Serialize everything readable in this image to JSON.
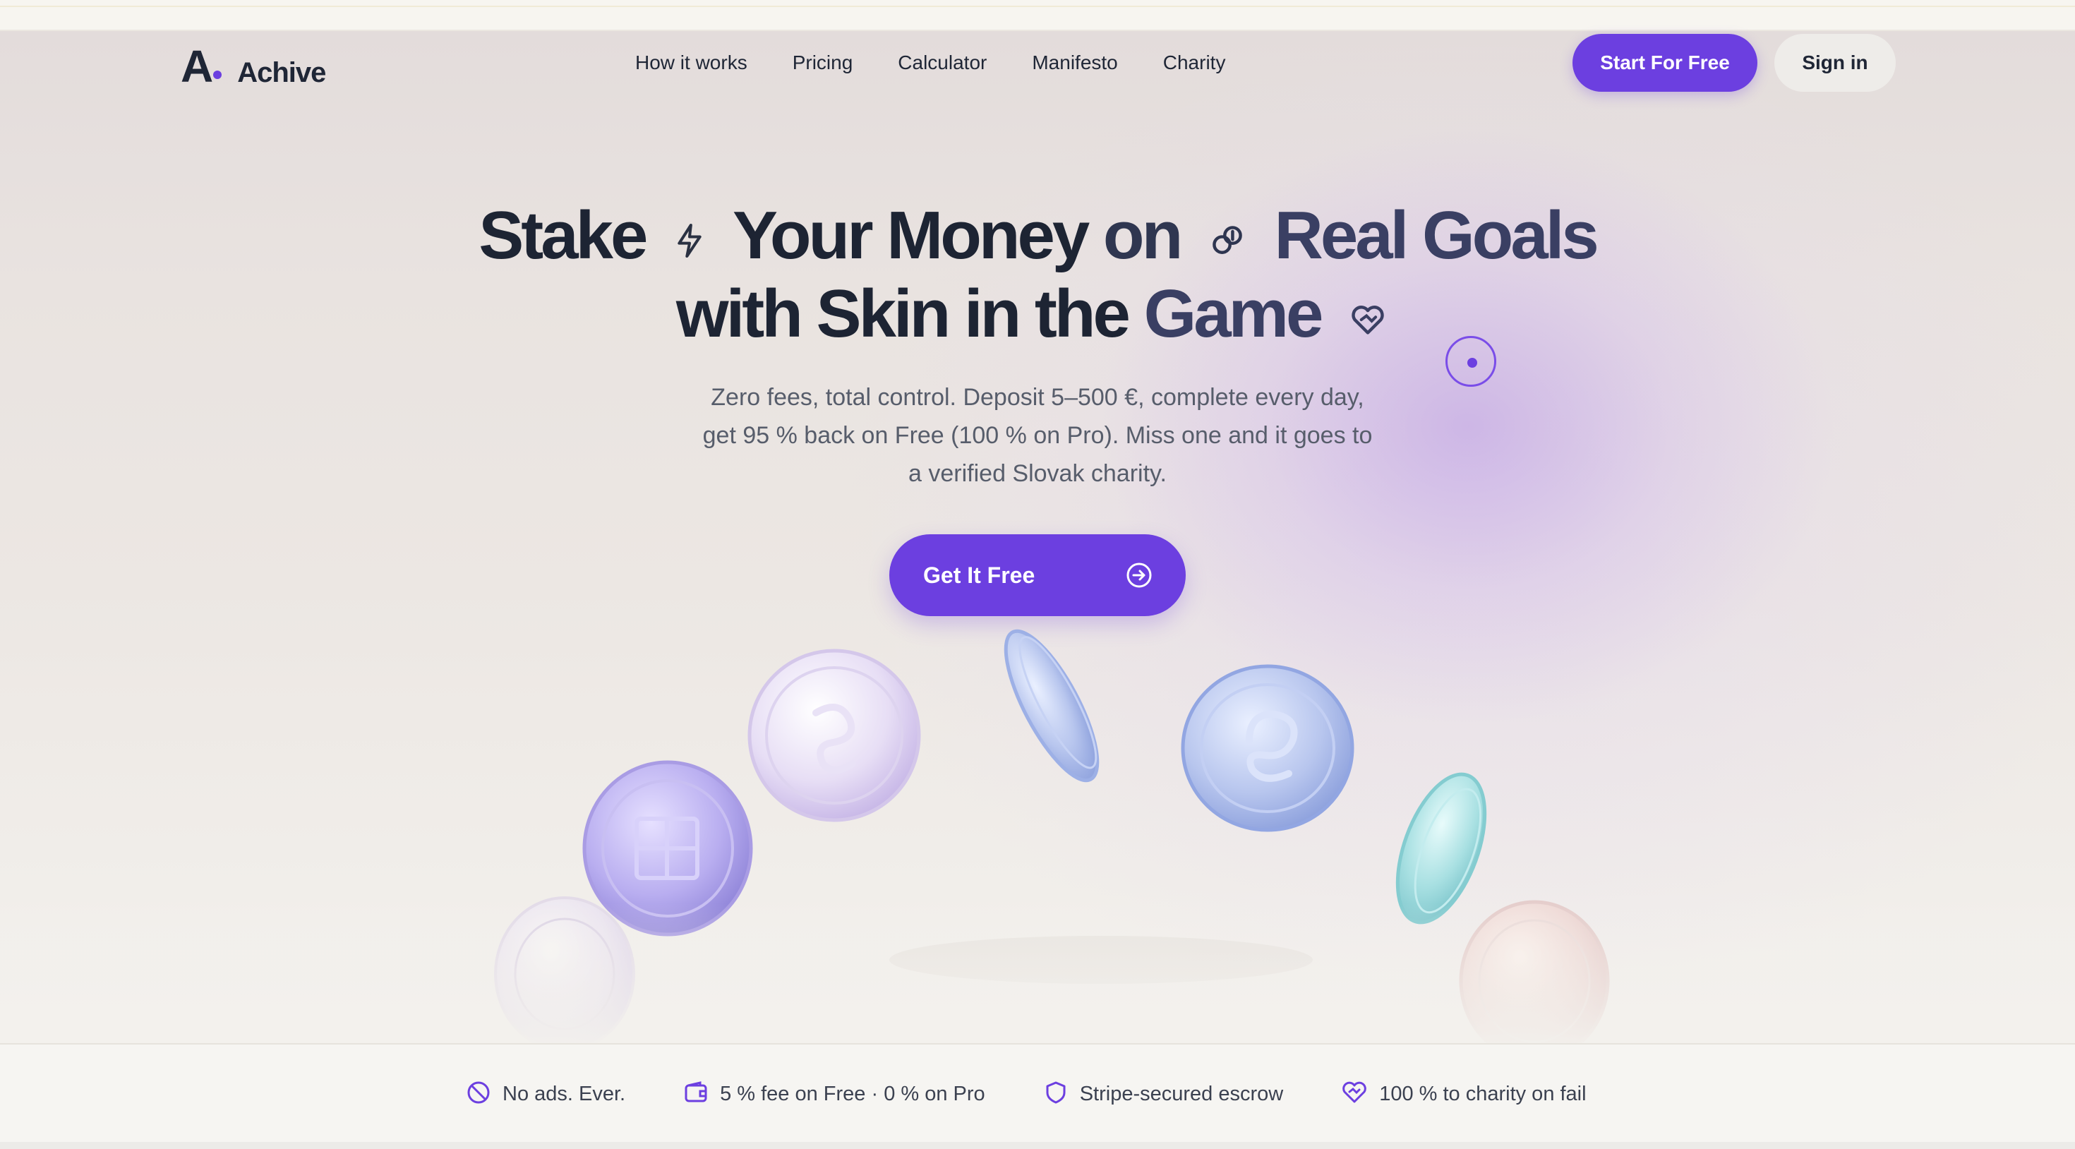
{
  "brand": {
    "mark": "A",
    "name": "Achive",
    "accent": "#6c3fe0"
  },
  "nav": {
    "links": [
      "How it works",
      "Pricing",
      "Calculator",
      "Manifesto",
      "Charity"
    ],
    "start_label": "Start For Free",
    "signin_label": "Sign in"
  },
  "hero": {
    "line1": {
      "a": "Stake",
      "b": "Your Money",
      "c": "on",
      "d": "Real Goals"
    },
    "line2": {
      "a": "with Skin in the",
      "b": "Game"
    },
    "sub_1": "Zero fees, total control. Deposit 5–500 €, complete every day,",
    "sub_2": "get 95 % back on Free (100 % on Pro). Miss one and it goes to",
    "sub_3": "a verified Slovak charity.",
    "cta_label": "Get It Free",
    "icons": [
      "lightning-icon",
      "link-icon",
      "heart-handshake-icon",
      "arrow-circle-right-icon"
    ]
  },
  "features": [
    {
      "icon": "no-ads-icon",
      "label": "No ads. Ever."
    },
    {
      "icon": "wallet-icon",
      "label": "5 % fee on Free · 0 % on Pro"
    },
    {
      "icon": "shield-icon",
      "label": "Stripe-secured escrow"
    },
    {
      "icon": "heart-handshake-icon",
      "label": "100 % to charity on fail"
    }
  ]
}
